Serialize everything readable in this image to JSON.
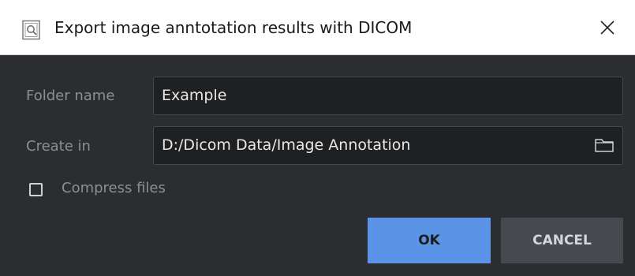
{
  "window": {
    "title": "Export image anntotation results with DICOM",
    "app_icon": "magnifier-document-icon",
    "close_icon": "close-icon"
  },
  "form": {
    "folder_name_label": "Folder name",
    "folder_name_value": "Example",
    "create_in_label": "Create in",
    "create_in_value": "D:/Dicom Data/Image Annotation",
    "browse_icon": "folder-icon",
    "compress_label": "Compress files",
    "compress_checked": false
  },
  "buttons": {
    "ok_label": "OK",
    "cancel_label": "CANCEL"
  },
  "colors": {
    "background": "#2b2d30",
    "field_background": "#1f2022",
    "primary": "#5b93e6",
    "secondary": "#46494d",
    "label": "#8c8f93"
  }
}
